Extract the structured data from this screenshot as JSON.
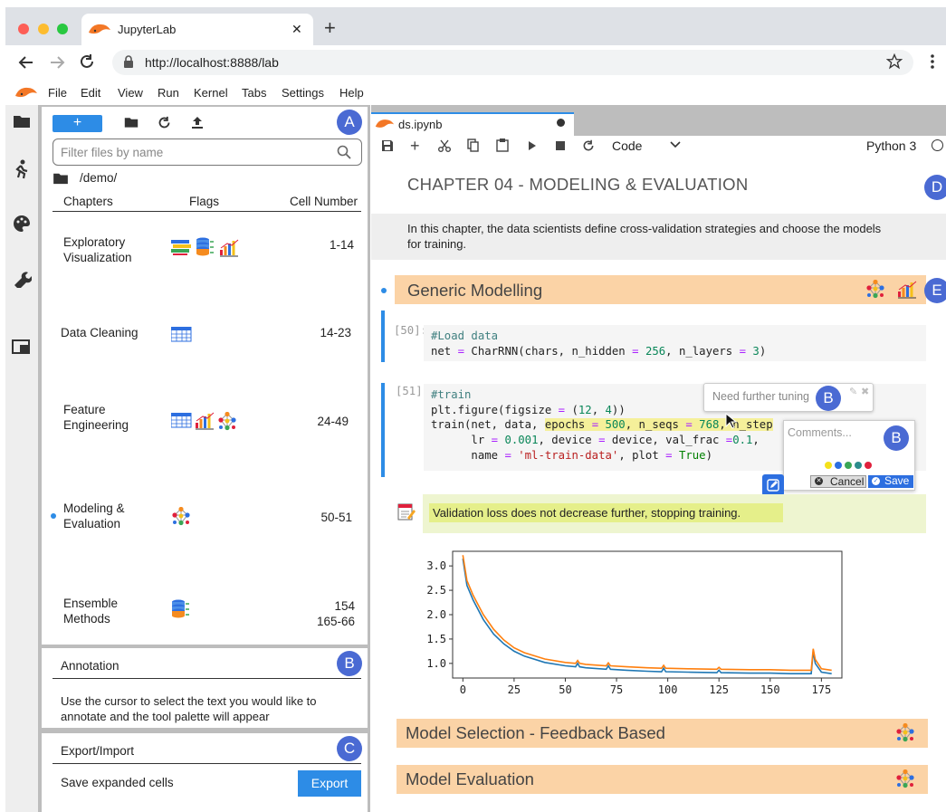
{
  "browser": {
    "tab_title": "JupyterLab",
    "close": "✕",
    "new_tab": "+",
    "url": "http://localhost:8888/lab"
  },
  "menu": [
    "File",
    "Edit",
    "View",
    "Run",
    "Kernel",
    "Tabs",
    "Settings",
    "Help"
  ],
  "filebrowser": {
    "new_label": "+",
    "filter_placeholder": "Filter files by name",
    "path": "/demo/",
    "badge": "A",
    "columns": [
      "Chapters",
      "Flags",
      "Cell Number"
    ],
    "rows": [
      {
        "chapter": "Exploratory Visualization",
        "cells": "1-14",
        "flags": [
          "table-stack-icon",
          "database-icon",
          "bar-chart-icon"
        ]
      },
      {
        "chapter": "Data Cleaning",
        "cells": "14-23",
        "flags": [
          "table-icon"
        ]
      },
      {
        "chapter": "Feature Engineering",
        "cells": "24-49",
        "flags": [
          "table-icon",
          "bar-chart-icon",
          "network-icon"
        ]
      },
      {
        "chapter": "Modeling & Evaluation",
        "cells": "50-51",
        "flags": [
          "network-icon"
        ],
        "active": true
      },
      {
        "chapter": "Ensemble Methods",
        "cells": "154\n165-66",
        "flags": [
          "database-icon"
        ]
      }
    ]
  },
  "annotation": {
    "title": "Annotation",
    "badge": "B",
    "text": "Use the cursor to select the text you would like to annotate and the tool palette will appear"
  },
  "export": {
    "title": "Export/Import",
    "badge": "C",
    "label": "Save expanded cells",
    "button": "Export"
  },
  "notebook": {
    "tab": "ds.ipynb",
    "cell_type": "Code",
    "kernel": "Python 3",
    "chapter_title": "CHAPTER 04 - MODELING & EVALUATION",
    "badge_d": "D",
    "intro": "In this chapter, the data scientists define cross-validation strategies and choose the models for training.",
    "section1": "Generic Modelling",
    "badge_e": "E",
    "cell50_prompt": "[50]:",
    "cell50_comment": "#Load data",
    "cell51_prompt": "[51]:",
    "cell51_comment": "#train",
    "tooltip": "Need further tuning",
    "tooltip_badge": "B",
    "comment_placeholder": "Comments...",
    "comment_badge": "B",
    "cancel": "Cancel",
    "save": "Save",
    "note": "Validation loss does not decrease further, stopping training.",
    "section2": "Model Selection - Feedback Based",
    "section3": "Model Evaluation",
    "palette_colors": [
      "#f5e11a",
      "#2d6fe0",
      "#3aa655",
      "#2c8c8c",
      "#e0203c"
    ]
  },
  "chart_data": {
    "type": "line",
    "title": "",
    "xlabel": "",
    "ylabel": "",
    "xlim": [
      -5,
      185
    ],
    "ylim": [
      0.7,
      3.3
    ],
    "xticks": [
      0,
      25,
      50,
      75,
      100,
      125,
      150,
      175
    ],
    "yticks": [
      1.0,
      1.5,
      2.0,
      2.5,
      3.0
    ],
    "series": [
      {
        "color": "#1f77b4",
        "x": [
          0,
          2,
          5,
          10,
          15,
          20,
          25,
          30,
          40,
          50,
          55,
          56,
          57,
          60,
          70,
          71,
          72,
          80,
          90,
          97,
          98,
          99,
          110,
          124,
          125,
          126,
          140,
          150,
          160,
          170,
          171,
          172,
          175,
          180
        ],
        "y": [
          3.15,
          2.6,
          2.3,
          1.9,
          1.6,
          1.4,
          1.25,
          1.15,
          1.02,
          0.95,
          0.93,
          1.0,
          0.93,
          0.91,
          0.88,
          0.95,
          0.88,
          0.86,
          0.84,
          0.83,
          0.9,
          0.83,
          0.82,
          0.81,
          0.86,
          0.81,
          0.8,
          0.8,
          0.79,
          0.79,
          1.24,
          1.0,
          0.82,
          0.79
        ]
      },
      {
        "color": "#ff7f0e",
        "x": [
          0,
          2,
          5,
          10,
          15,
          20,
          25,
          30,
          40,
          50,
          55,
          56,
          57,
          60,
          70,
          71,
          72,
          80,
          90,
          97,
          98,
          99,
          110,
          124,
          125,
          126,
          140,
          150,
          160,
          170,
          171,
          172,
          175,
          180
        ],
        "y": [
          3.22,
          2.7,
          2.4,
          2.0,
          1.7,
          1.48,
          1.32,
          1.22,
          1.09,
          1.02,
          1.0,
          1.06,
          1.0,
          0.98,
          0.95,
          1.01,
          0.95,
          0.93,
          0.91,
          0.9,
          0.96,
          0.9,
          0.89,
          0.88,
          0.92,
          0.88,
          0.87,
          0.87,
          0.86,
          0.86,
          1.3,
          1.08,
          0.89,
          0.86
        ]
      }
    ]
  }
}
